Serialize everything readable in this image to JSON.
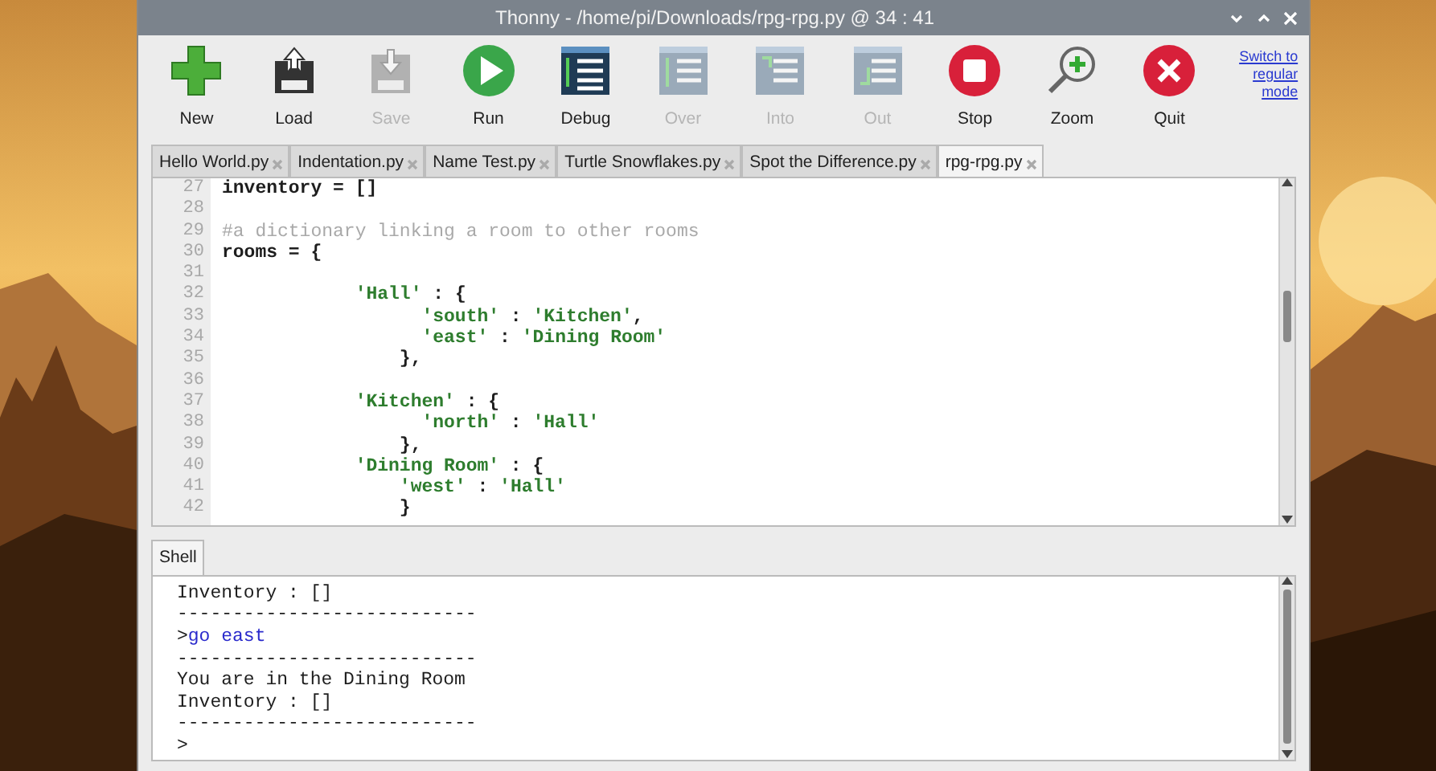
{
  "window": {
    "title": "Thonny  -  /home/pi/Downloads/rpg-rpg.py  @  34 : 41"
  },
  "toolbar": [
    {
      "kind": "new",
      "label": "New",
      "disabled": false
    },
    {
      "kind": "load",
      "label": "Load",
      "disabled": false
    },
    {
      "kind": "save",
      "label": "Save",
      "disabled": true
    },
    {
      "kind": "run",
      "label": "Run",
      "disabled": false
    },
    {
      "kind": "debug",
      "label": "Debug",
      "disabled": false
    },
    {
      "kind": "over",
      "label": "Over",
      "disabled": true
    },
    {
      "kind": "into",
      "label": "Into",
      "disabled": true
    },
    {
      "kind": "out",
      "label": "Out",
      "disabled": true
    },
    {
      "kind": "stop",
      "label": "Stop",
      "disabled": false
    },
    {
      "kind": "zoom",
      "label": "Zoom",
      "disabled": false
    },
    {
      "kind": "quit",
      "label": "Quit",
      "disabled": false
    }
  ],
  "mode_link": "Switch to regular mode",
  "tabs": [
    {
      "label": "Hello World.py",
      "selected": false
    },
    {
      "label": "Indentation.py",
      "selected": false
    },
    {
      "label": "Name Test.py",
      "selected": false
    },
    {
      "label": "Turtle Snowflakes.py",
      "selected": false
    },
    {
      "label": "Spot the Difference.py",
      "selected": false
    },
    {
      "label": "rpg-rpg.py",
      "selected": true
    }
  ],
  "editor": {
    "lines": [
      {
        "number": "27",
        "segments": [
          {
            "kind": "code",
            "text": "inventory = []"
          }
        ]
      },
      {
        "number": "28"
      },
      {
        "number": "29",
        "segments": [
          {
            "kind": "comment",
            "text": "#a dictionary linking a room to other rooms"
          }
        ]
      },
      {
        "number": "30",
        "segments": [
          {
            "kind": "code",
            "text": "rooms = {"
          }
        ]
      },
      {
        "number": "31"
      },
      {
        "number": "32",
        "segments": [
          {
            "kind": "string",
            "text": "            'Hall'"
          },
          {
            "kind": "code",
            "text": " : {"
          }
        ]
      },
      {
        "number": "33",
        "segments": [
          {
            "kind": "string",
            "text": "                  'south'"
          },
          {
            "kind": "code",
            "text": " : "
          },
          {
            "kind": "string",
            "text": "'Kitchen'"
          },
          {
            "kind": "code",
            "text": ","
          }
        ]
      },
      {
        "number": "34",
        "segments": [
          {
            "kind": "string",
            "text": "                  'east'"
          },
          {
            "kind": "code",
            "text": " : "
          },
          {
            "kind": "string",
            "text": "'Dining Room'"
          }
        ]
      },
      {
        "number": "35",
        "segments": [
          {
            "kind": "code",
            "text": "                },"
          }
        ]
      },
      {
        "number": "36"
      },
      {
        "number": "37",
        "segments": [
          {
            "kind": "string",
            "text": "            'Kitchen'"
          },
          {
            "kind": "code",
            "text": " : {"
          }
        ]
      },
      {
        "number": "38",
        "segments": [
          {
            "kind": "string",
            "text": "                  'north'"
          },
          {
            "kind": "code",
            "text": " : "
          },
          {
            "kind": "string",
            "text": "'Hall'"
          }
        ]
      },
      {
        "number": "39",
        "segments": [
          {
            "kind": "code",
            "text": "                },"
          }
        ]
      },
      {
        "number": "40",
        "segments": [
          {
            "kind": "string",
            "text": "            'Dining Room'"
          },
          {
            "kind": "code",
            "text": " : {"
          }
        ]
      },
      {
        "number": "41",
        "segments": [
          {
            "kind": "string",
            "text": "                'west'"
          },
          {
            "kind": "code",
            "text": " : "
          },
          {
            "kind": "string",
            "text": "'Hall'"
          }
        ]
      },
      {
        "number": "42",
        "segments": [
          {
            "kind": "code",
            "text": "                }"
          }
        ]
      }
    ]
  },
  "shell": {
    "tab": "Shell",
    "lines": [
      {
        "segments": [
          {
            "kind": "output",
            "text": "Inventory : []"
          }
        ]
      },
      {
        "segments": [
          {
            "kind": "output",
            "text": "---------------------------"
          }
        ]
      },
      {
        "segments": [
          {
            "kind": "output",
            "text": ">"
          },
          {
            "kind": "input",
            "text": "go east"
          }
        ]
      },
      {
        "segments": [
          {
            "kind": "output",
            "text": "---------------------------"
          }
        ]
      },
      {
        "segments": [
          {
            "kind": "output",
            "text": "You are in the Dining Room"
          }
        ]
      },
      {
        "segments": [
          {
            "kind": "output",
            "text": "Inventory : []"
          }
        ]
      },
      {
        "segments": [
          {
            "kind": "output",
            "text": "---------------------------"
          }
        ]
      },
      {
        "segments": [
          {
            "kind": "output",
            "text": ">"
          }
        ]
      }
    ]
  }
}
